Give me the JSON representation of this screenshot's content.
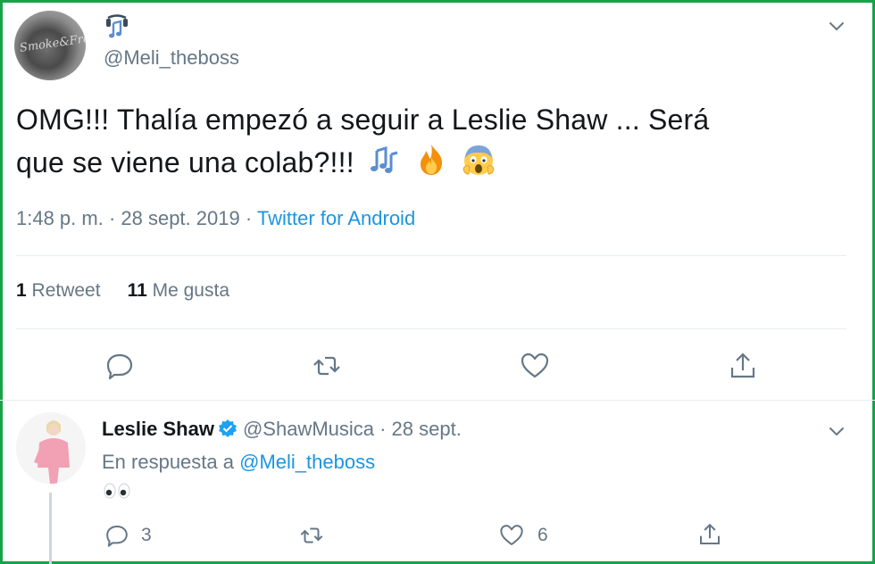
{
  "tweet": {
    "username": "@Meli_theboss",
    "user_emoji": "musical-notes-emoji",
    "avatar_text": "Smoke&Free",
    "text_line1": "OMG!!! Thalía empezó a seguir a Leslie Shaw ... Será",
    "text_line2": "que se viene una colab?!!!",
    "inline_emojis": [
      "musical-notes-emoji",
      "fire-emoji",
      "screaming-face-emoji"
    ],
    "time": "1:48 p. m. · 28 sept. 2019 · ",
    "source": "Twitter for Android",
    "retweet_count": "1",
    "retweet_label": "Retweet",
    "like_count": "11",
    "like_label": "Me gusta",
    "actions": [
      "reply-icon",
      "retweet-icon",
      "like-icon",
      "share-icon"
    ]
  },
  "reply": {
    "display_name": "Leslie Shaw",
    "handle_date": "@ShawMusica · 28 sept.",
    "in_reply_prefix": "En respuesta a ",
    "in_reply_mention": "@Meli_theboss",
    "body_emoji": "eyes-emoji",
    "reply_count": "3",
    "like_count": "6"
  },
  "colors": {
    "frame": "#17a34a",
    "text": "#14171a",
    "muted": "#657786",
    "link": "#1b95e0",
    "divider": "#e6ecf0"
  }
}
